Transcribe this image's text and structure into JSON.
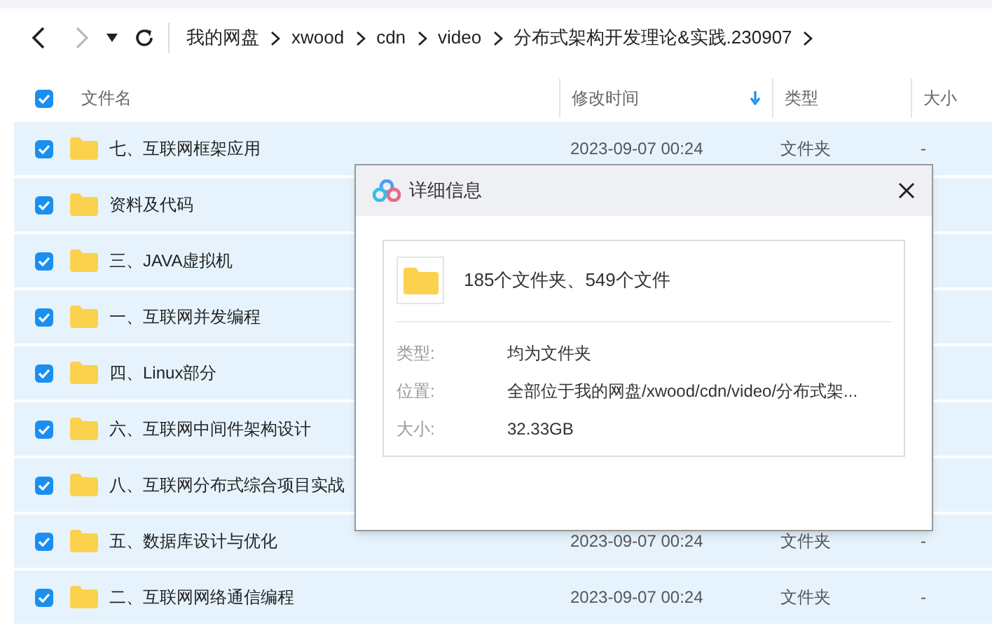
{
  "breadcrumb": [
    {
      "label": "我的网盘"
    },
    {
      "label": "xwood"
    },
    {
      "label": "cdn"
    },
    {
      "label": "video"
    },
    {
      "label": "分布式架构开发理论&实践.230907"
    }
  ],
  "select_all_checked": true,
  "columns": [
    {
      "label": "文件名"
    },
    {
      "label": "修改时间",
      "sorted": true
    },
    {
      "label": "类型"
    },
    {
      "label": "大小"
    }
  ],
  "rows": [
    {
      "name": "七、互联网框架应用",
      "modified": "2023-09-07 00:24",
      "type": "文件夹",
      "size": "-",
      "checked": true
    },
    {
      "name": "资料及代码",
      "checked": true
    },
    {
      "name": "三、JAVA虚拟机",
      "checked": true
    },
    {
      "name": "一、互联网并发编程",
      "checked": true
    },
    {
      "name": "四、Linux部分",
      "checked": true
    },
    {
      "name": "六、互联网中间件架构设计",
      "checked": true
    },
    {
      "name": "八、互联网分布式综合项目实战",
      "checked": true
    },
    {
      "name": "五、数据库设计与优化",
      "modified": "2023-09-07 00:24",
      "type": "文件夹",
      "size": "-",
      "checked": true
    },
    {
      "name": "二、互联网网络通信编程",
      "modified": "2023-09-07 00:24",
      "type": "文件夹",
      "size": "-",
      "checked": true
    }
  ],
  "dialog": {
    "title": "详细信息",
    "summary": "185个文件夹、549个文件",
    "details": [
      {
        "label": "类型:",
        "value": "均为文件夹"
      },
      {
        "label": "位置:",
        "value": "全部位于我的网盘/xwood/cdn/video/分布式架..."
      },
      {
        "label": "大小:",
        "value": "32.33GB"
      }
    ]
  }
}
